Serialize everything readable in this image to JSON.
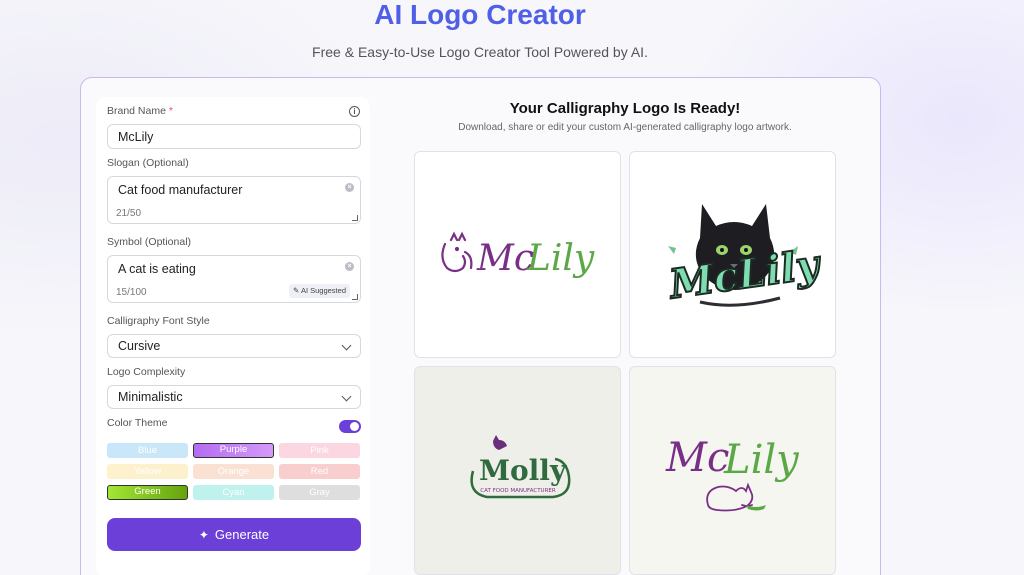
{
  "header": {
    "title": "AI Logo Creator",
    "subtitle": "Free & Easy-to-Use Logo Creator Tool Powered by AI."
  },
  "form": {
    "brand_name": {
      "label": "Brand Name",
      "required_mark": "*",
      "value": "McLily"
    },
    "slogan": {
      "label": "Slogan (Optional)",
      "value": "Cat food manufacturer",
      "counter": "21/50"
    },
    "symbol": {
      "label": "Symbol (Optional)",
      "value": "A cat is eating",
      "counter": "15/100",
      "ai_chip": "AI Suggested"
    },
    "font_style": {
      "label": "Calligraphy Font Style",
      "value": "Cursive"
    },
    "complexity": {
      "label": "Logo Complexity",
      "value": "Minimalistic"
    },
    "color_theme": {
      "label": "Color Theme",
      "toggle_on": true,
      "swatches": [
        {
          "label": "Blue",
          "color": "#9fd2f5",
          "selected": false
        },
        {
          "label": "Purple",
          "color": "#b36df2",
          "selected": true
        },
        {
          "label": "Pink",
          "color": "#f9b8cc",
          "selected": false
        },
        {
          "label": "Yellow",
          "color": "#fde7a6",
          "selected": false
        },
        {
          "label": "Orange",
          "color": "#f8c9b0",
          "selected": false
        },
        {
          "label": "Red",
          "color": "#f4a7a9",
          "selected": false
        },
        {
          "label": "Green",
          "color": "#84cc16",
          "selected": true
        },
        {
          "label": "Cyan",
          "color": "#8be8e0",
          "selected": false
        },
        {
          "label": "Gray",
          "color": "#c4c4c4",
          "selected": false
        }
      ]
    },
    "generate_label": "Generate"
  },
  "results": {
    "title": "Your Calligraphy Logo Is Ready!",
    "subtitle": "Download, share or edit your custom AI-generated calligraphy logo artwork.",
    "logos": [
      {
        "name": "McLily",
        "style": "purple-green cursive with cat outline"
      },
      {
        "name": "McLily",
        "style": "black cat illustration with mint lettering"
      },
      {
        "name": "Molly",
        "tagline": "CAT FOOD MANUFACTURER",
        "style": "green emblem"
      },
      {
        "name": "McLily",
        "style": "purple-green cursive with eating cat"
      }
    ]
  },
  "colors": {
    "accent": "#6c3fd8",
    "title_blue": "#4f5fe6",
    "logo_purple": "#7a2f86",
    "logo_green": "#5aa846"
  }
}
